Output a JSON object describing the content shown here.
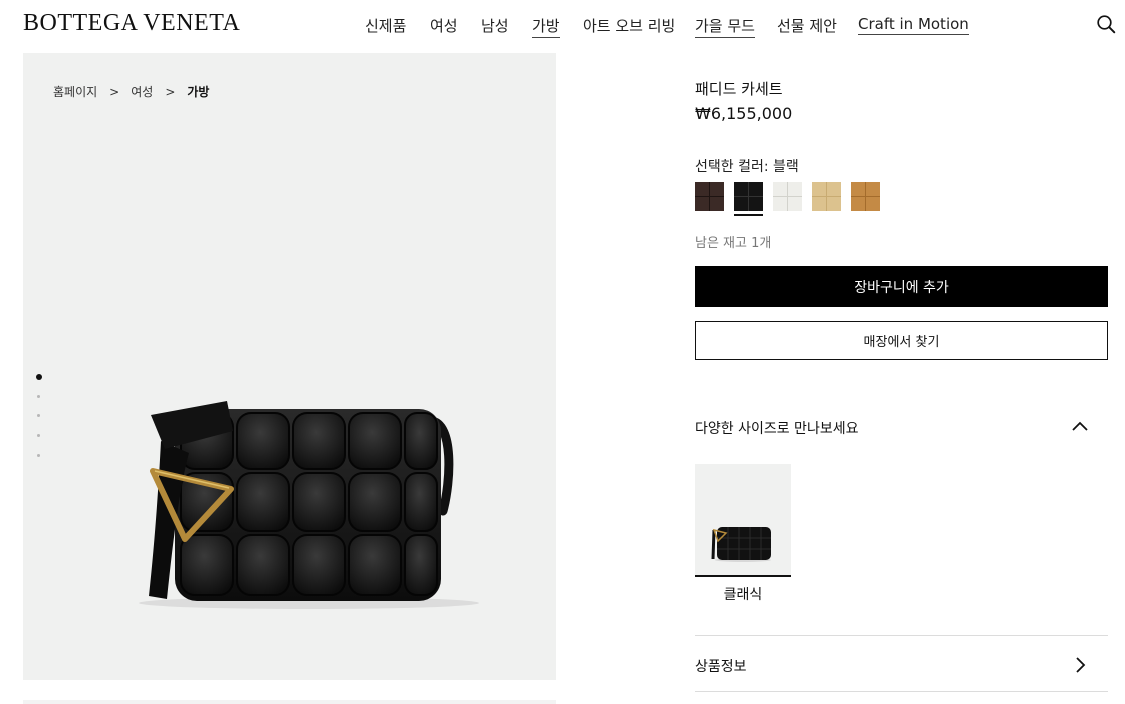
{
  "header": {
    "logo": "BOTTEGA VENETA",
    "nav": [
      {
        "label": "신제품"
      },
      {
        "label": "여성"
      },
      {
        "label": "남성"
      },
      {
        "label": "가방"
      },
      {
        "label": "아트 오브 리빙"
      },
      {
        "label": "가을 무드"
      },
      {
        "label": "선물 제안"
      },
      {
        "label": "Craft in Motion"
      }
    ],
    "search_icon": "search-icon"
  },
  "breadcrumb": {
    "items": [
      "홈페이지",
      "여성",
      "가방"
    ],
    "separator": ">"
  },
  "gallery": {
    "slide_count": 5,
    "active_slide": 1
  },
  "product": {
    "name": "패디드 카세트",
    "price": "₩6,155,000",
    "color_label": "선택한 컬러: 블랙",
    "swatches": [
      {
        "name": "dark-brown",
        "color": "#3b2a26"
      },
      {
        "name": "black",
        "color": "#141414",
        "selected": true
      },
      {
        "name": "white",
        "color": "#eeeeea"
      },
      {
        "name": "beige",
        "color": "#dcc28e"
      },
      {
        "name": "tan",
        "color": "#c48a45"
      }
    ],
    "stock": "남은 재고 1개",
    "add_to_cart": "장바구니에 추가",
    "find_in_store": "매장에서 찾기"
  },
  "sizes": {
    "title": "다양한 사이즈로 만나보세요",
    "items": [
      {
        "label": "클래식"
      }
    ]
  },
  "accordion": {
    "product_info": "상품정보"
  }
}
